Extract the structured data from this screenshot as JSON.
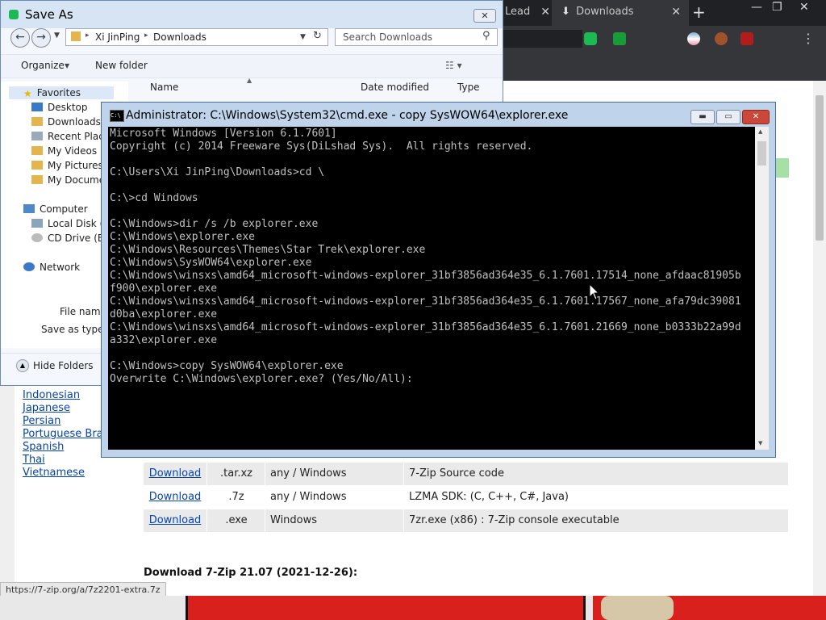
{
  "browser": {
    "tabs": [
      {
        "label": "Lead",
        "close": "✕"
      },
      {
        "label": "Downloads",
        "close": "✕"
      }
    ],
    "new_tab": "+",
    "window_controls": [
      "—",
      "❐",
      "✕"
    ],
    "menu": "⋮",
    "status_url": "https://7-zip.org/a/7z2201-extra.7z"
  },
  "page": {
    "languages": [
      "Indonesian",
      "Japanese",
      "Persian",
      "Portuguese Brazilian",
      "Spanish",
      "Thai",
      "Vietnamese"
    ],
    "download_rows": [
      {
        "link": "Download",
        "type": ".tar.xz",
        "system": "any / Windows",
        "description": "7-Zip Source code"
      },
      {
        "link": "Download",
        "type": ".7z",
        "system": "any / Windows",
        "description": "LZMA SDK: (C, C++, C#, Java)"
      },
      {
        "link": "Download",
        "type": ".exe",
        "system": "Windows",
        "description": "7zr.exe (x86) : 7-Zip console executable"
      }
    ],
    "section_heading": "Download 7-Zip 21.07 (2021-12-26):"
  },
  "save_as": {
    "title": "Save As",
    "close": "✕",
    "path": [
      "Xi JinPing",
      "Downloads"
    ],
    "search_placeholder": "Search Downloads",
    "organize": "Organize",
    "new_folder": "New folder",
    "columns": [
      "Name",
      "Date modified",
      "Type"
    ],
    "favorites_label": "Favorites",
    "favorites": [
      "Desktop",
      "Downloads",
      "Recent Plac",
      "My Videos",
      "My Pictures",
      "My Docume"
    ],
    "computer_label": "Computer",
    "computer": [
      "Local Disk (",
      "CD Drive (E"
    ],
    "network_label": "Network",
    "file_name_label": "File name",
    "save_as_type_label": "Save as type",
    "hide_folders": "Hide Folders"
  },
  "cmd": {
    "title": "Administrator: C:\\Windows\\System32\\cmd.exe - copy  SysWOW64\\explorer.exe",
    "lines": [
      "Microsoft Windows [Version 6.1.7601]",
      "Copyright (c) 2014 Freeware Sys(DiLshad Sys).  All rights reserved.",
      "",
      "C:\\Users\\Xi JinPing\\Downloads>cd \\",
      "",
      "C:\\>cd Windows",
      "",
      "C:\\Windows>dir /s /b explorer.exe",
      "C:\\Windows\\explorer.exe",
      "C:\\Windows\\Resources\\Themes\\Star Trek\\explorer.exe",
      "C:\\Windows\\SysWOW64\\explorer.exe",
      "C:\\Windows\\winsxs\\amd64_microsoft-windows-explorer_31bf3856ad364e35_6.1.7601.17514_none_afdaac81905b",
      "f900\\explorer.exe",
      "C:\\Windows\\winsxs\\amd64_microsoft-windows-explorer_31bf3856ad364e35_6.1.7601.17567_none_afa79dc39081",
      "d0ba\\explorer.exe",
      "C:\\Windows\\winsxs\\amd64_microsoft-windows-explorer_31bf3856ad364e35_6.1.7601.21669_none_b0333b22a99d",
      "a332\\explorer.exe",
      "",
      "C:\\Windows>copy SysWOW64\\explorer.exe",
      "Overwrite C:\\Windows\\explorer.exe? (Yes/No/All):"
    ]
  },
  "colors": {
    "link": "#0645ad",
    "console_bg": "#000000",
    "console_fg": "#c0c0c0",
    "titlebar": "#bfd3ea"
  },
  "icons": [
    "download-icon",
    "back-arrow-icon",
    "forward-arrow-icon",
    "refresh-icon",
    "search-icon",
    "star-icon",
    "folder-icon",
    "computer-icon",
    "network-icon",
    "cmd-icon"
  ]
}
